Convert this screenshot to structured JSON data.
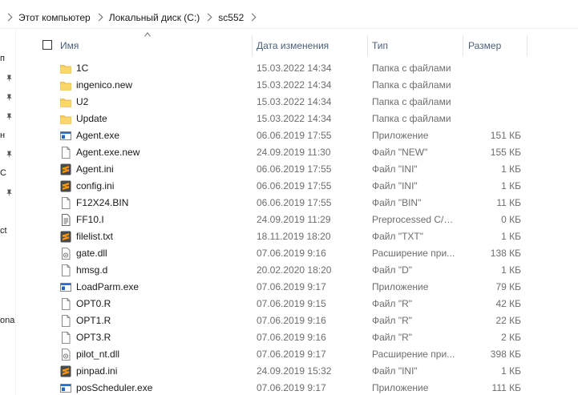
{
  "breadcrumb": [
    "Этот компьютер",
    "Локальный диск (C:)",
    "sc552"
  ],
  "nav": {
    "items": [
      "п",
      "н",
      "C",
      "ct",
      "onal"
    ]
  },
  "columns": {
    "name": "Имя",
    "date": "Дата изменения",
    "type": "Тип",
    "size": "Размер"
  },
  "files": [
    {
      "name": "1C",
      "date": "15.03.2022 14:34",
      "type": "Папка с файлами",
      "size": "",
      "icon": "folder-icon"
    },
    {
      "name": "ingenico.new",
      "date": "15.03.2022 14:34",
      "type": "Папка с файлами",
      "size": "",
      "icon": "folder-icon"
    },
    {
      "name": "U2",
      "date": "15.03.2022 14:34",
      "type": "Папка с файлами",
      "size": "",
      "icon": "folder-icon"
    },
    {
      "name": "Update",
      "date": "15.03.2022 14:34",
      "type": "Папка с файлами",
      "size": "",
      "icon": "folder-icon"
    },
    {
      "name": "Agent.exe",
      "date": "06.06.2019 17:55",
      "type": "Приложение",
      "size": "151 КБ",
      "icon": "application-icon"
    },
    {
      "name": "Agent.exe.new",
      "date": "24.09.2019 11:30",
      "type": "Файл \"NEW\"",
      "size": "155 КБ",
      "icon": "blank-file-icon"
    },
    {
      "name": "Agent.ini",
      "date": "06.06.2019 17:55",
      "type": "Файл \"INI\"",
      "size": "1 КБ",
      "icon": "sublime-file-icon"
    },
    {
      "name": "config.ini",
      "date": "06.06.2019 17:55",
      "type": "Файл \"INI\"",
      "size": "1 КБ",
      "icon": "sublime-file-icon"
    },
    {
      "name": "F12X24.BIN",
      "date": "06.06.2019 17:55",
      "type": "Файл \"BIN\"",
      "size": "11 КБ",
      "icon": "blank-file-icon"
    },
    {
      "name": "FF10.I",
      "date": "24.09.2019 11:29",
      "type": "Preprocessed C/C...",
      "size": "0 КБ",
      "icon": "text-file-icon"
    },
    {
      "name": "filelist.txt",
      "date": "18.11.2019 18:20",
      "type": "Файл \"TXT\"",
      "size": "1 КБ",
      "icon": "sublime-file-icon"
    },
    {
      "name": "gate.dll",
      "date": "07.06.2019 9:16",
      "type": "Расширение при...",
      "size": "138 КБ",
      "icon": "dll-file-icon"
    },
    {
      "name": "hmsg.d",
      "date": "20.02.2020 18:20",
      "type": "Файл \"D\"",
      "size": "1 КБ",
      "icon": "blank-file-icon"
    },
    {
      "name": "LoadParm.exe",
      "date": "07.06.2019 9:17",
      "type": "Приложение",
      "size": "79 КБ",
      "icon": "application-icon"
    },
    {
      "name": "OPT0.R",
      "date": "07.06.2019 9:15",
      "type": "Файл \"R\"",
      "size": "42 КБ",
      "icon": "blank-file-icon"
    },
    {
      "name": "OPT1.R",
      "date": "07.06.2019 9:16",
      "type": "Файл \"R\"",
      "size": "22 КБ",
      "icon": "blank-file-icon"
    },
    {
      "name": "OPT3.R",
      "date": "07.06.2019 9:16",
      "type": "Файл \"R\"",
      "size": "2 КБ",
      "icon": "blank-file-icon"
    },
    {
      "name": "pilot_nt.dll",
      "date": "07.06.2019 9:17",
      "type": "Расширение при...",
      "size": "398 КБ",
      "icon": "dll-file-icon"
    },
    {
      "name": "pinpad.ini",
      "date": "24.09.2019 15:32",
      "type": "Файл \"INI\"",
      "size": "1 КБ",
      "icon": "sublime-file-icon"
    },
    {
      "name": "posScheduler.exe",
      "date": "07.06.2019 9:17",
      "type": "Приложение",
      "size": "111 КБ",
      "icon": "application-icon"
    }
  ],
  "colors": {
    "folder": "#f8cf5a",
    "sublime": "#ff9800",
    "header_text": "#4c607a",
    "meta_text": "#6d6d6d",
    "app_blue": "#1e66c8"
  }
}
